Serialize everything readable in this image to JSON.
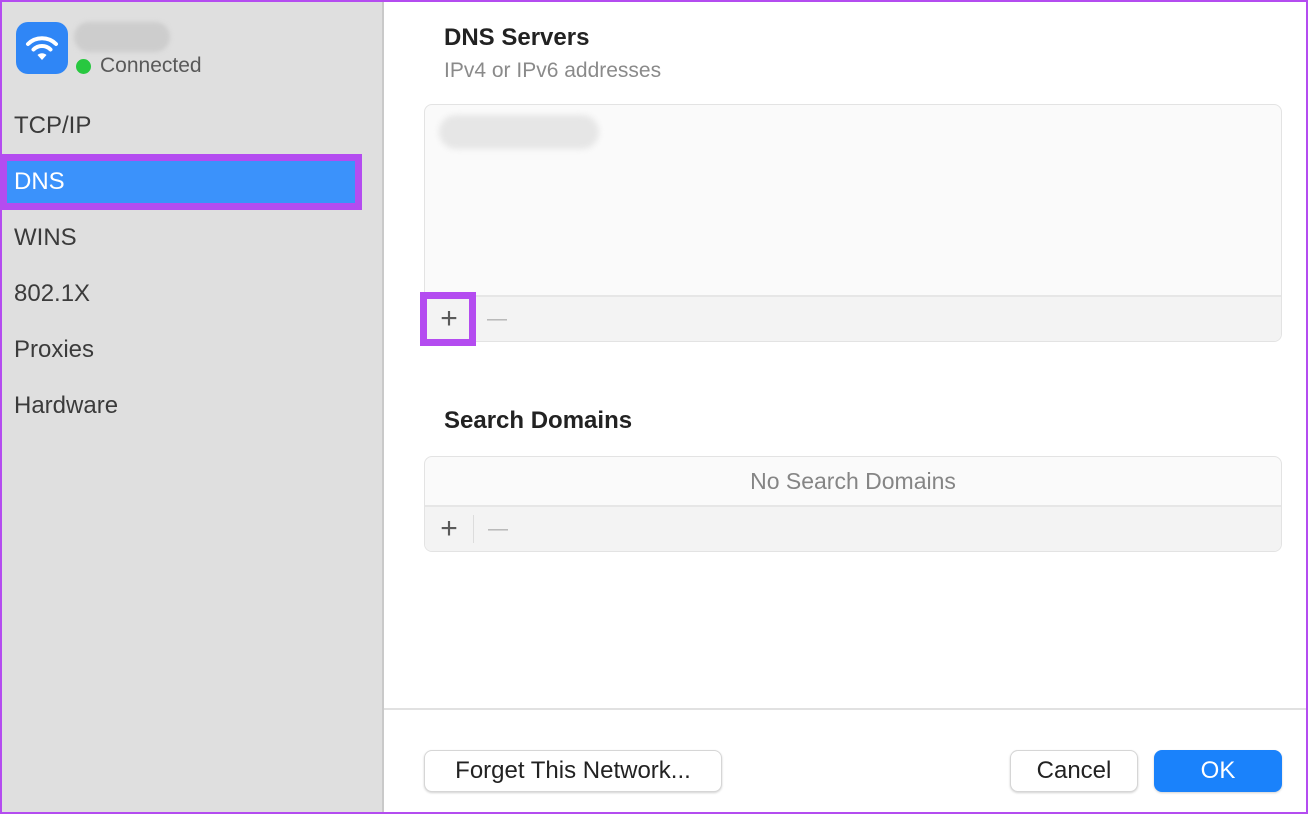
{
  "sidebar": {
    "network": {
      "icon": "wifi-icon",
      "name_redacted": true,
      "status": "Connected",
      "status_color": "#28c840"
    },
    "items": [
      {
        "label": "TCP/IP",
        "active": false
      },
      {
        "label": "DNS",
        "active": true
      },
      {
        "label": "WINS",
        "active": false
      },
      {
        "label": "802.1X",
        "active": false
      },
      {
        "label": "Proxies",
        "active": false
      },
      {
        "label": "Hardware",
        "active": false
      }
    ]
  },
  "dns_servers": {
    "title": "DNS Servers",
    "subtitle": "IPv4 or IPv6 addresses",
    "entries_redacted": true,
    "add_label": "+",
    "remove_label": "—"
  },
  "search_domains": {
    "title": "Search Domains",
    "empty_text": "No Search Domains",
    "add_label": "+",
    "remove_label": "—"
  },
  "footer": {
    "forget_label": "Forget This Network...",
    "cancel_label": "Cancel",
    "ok_label": "OK"
  },
  "colors": {
    "accent": "#1a82fb",
    "selection": "#3b92fb",
    "highlight": "#b44cf0"
  }
}
